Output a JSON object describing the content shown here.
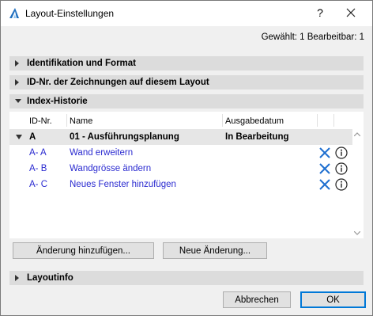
{
  "window": {
    "title": "Layout-Einstellungen",
    "help_label": "?",
    "close_label": "×"
  },
  "selection_info": "Gewählt: 1 Bearbeitbar: 1",
  "sections": {
    "identification": "Identifikation und Format",
    "drawing_ids": "ID-Nr. der Zeichnungen auf diesem Layout",
    "index_history": "Index-Historie",
    "layoutinfo": "Layoutinfo"
  },
  "table": {
    "columns": [
      "ID-Nr.",
      "Name",
      "Ausgabedatum"
    ],
    "group": {
      "id": "A",
      "name": "01 - Ausführungsplanung",
      "date": "In Bearbeitung"
    },
    "rows": [
      {
        "id": "A- A",
        "name": "Wand erweitern"
      },
      {
        "id": "A- B",
        "name": "Wandgrösse ändern"
      },
      {
        "id": "A- C",
        "name": "Neues Fenster hinzufügen"
      }
    ]
  },
  "buttons": {
    "add_change": "Änderung hinzufügen...",
    "new_change": "Neue Änderung...",
    "cancel": "Abbrechen",
    "ok": "OK"
  },
  "colors": {
    "link_blue": "#2a2ad0",
    "delete_blue": "#1e6fd0",
    "section_bg": "#dcdcdc"
  }
}
